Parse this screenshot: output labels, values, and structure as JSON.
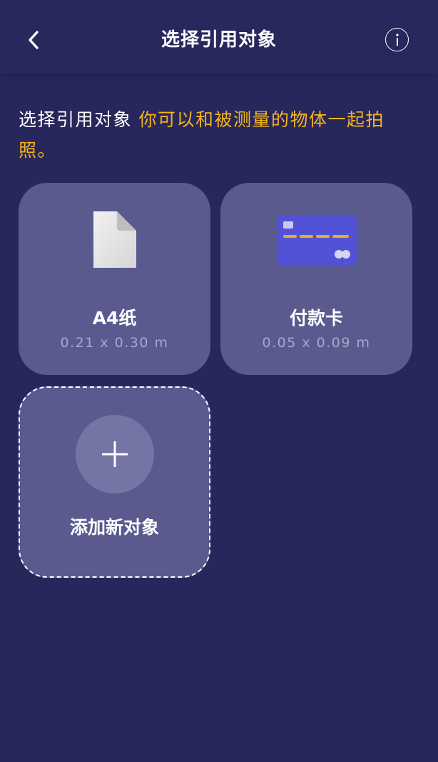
{
  "header": {
    "title": "选择引用对象",
    "back_icon": "chevron-left-icon",
    "info_icon": "info-icon"
  },
  "intro": {
    "prefix": "选择引用对象 ",
    "highlight": "你可以和被测量的物体一起拍照。"
  },
  "objects": [
    {
      "name": "A4纸",
      "dimensions": "0.21 x 0.30 m",
      "icon": "document-icon"
    },
    {
      "name": "付款卡",
      "dimensions": "0.05 x 0.09 m",
      "icon": "credit-card-icon"
    }
  ],
  "add_object": {
    "label": "添加新对象",
    "icon": "plus-icon"
  },
  "colors": {
    "background": "#27275c",
    "card": "#5a5a8f",
    "highlight": "#f5b51c",
    "card_icon": "#5252d6",
    "card_stripe": "#e6b01b"
  }
}
